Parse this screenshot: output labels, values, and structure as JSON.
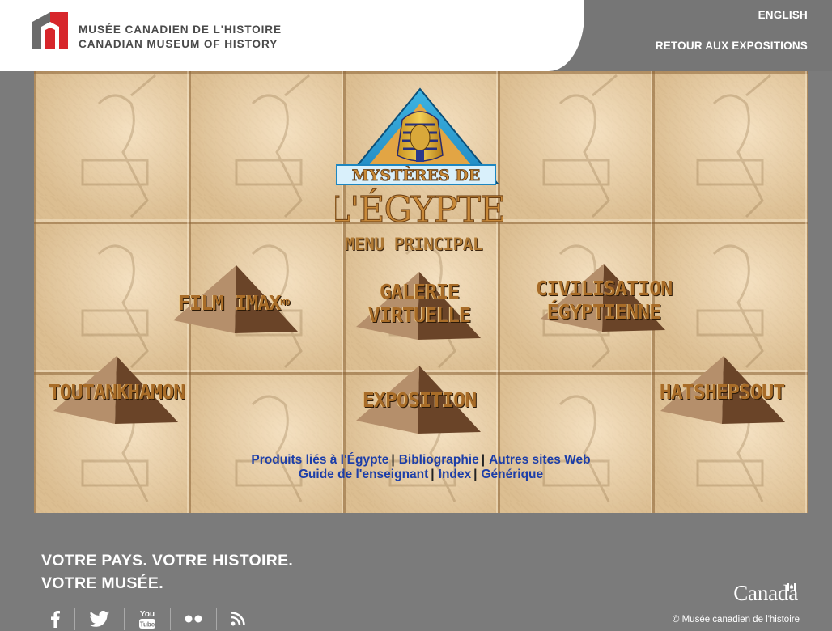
{
  "header": {
    "museum_name_fr": "MUSÉE CANADIEN DE L'HISTOIRE",
    "museum_name_en": "CANADIAN MUSEUM OF HISTORY",
    "english_link": "ENGLISH",
    "retour_link": "RETOUR AUX EXPOSITIONS"
  },
  "main": {
    "title_line1": "MYSTÈRES DE",
    "title_line2": "L'ÉGYPTE",
    "menu_label": "MENU PRINCIPAL",
    "items": [
      {
        "label": "FILM IMAX",
        "suffix": "MD"
      },
      {
        "label_line1": "GALERIE",
        "label_line2": "VIRTUELLE"
      },
      {
        "label_line1": "CIVILISATION",
        "label_line2": "ÉGYPTIENNE"
      },
      {
        "label": "TOUTANKHAMON"
      },
      {
        "label": "EXPOSITION"
      },
      {
        "label": "HATSHEPSOUT"
      }
    ],
    "links_row1": [
      "Produits liés à l'Égypte",
      "Bibliographie",
      "Autres sites Web"
    ],
    "links_row2": [
      "Guide de l'enseignant",
      "Index",
      "Générique"
    ],
    "separator": "|"
  },
  "footer": {
    "slogan_line1": "VOTRE PAYS. VOTRE HISTOIRE.",
    "slogan_line2": "VOTRE MUSÉE.",
    "social_icons": [
      "facebook-icon",
      "twitter-icon",
      "youtube-icon",
      "flickr-icon",
      "rss-icon"
    ],
    "youtube_text": "You Tube",
    "canada_wordmark": "Canada",
    "copyright": "© Musée canadien de l'histoire"
  },
  "colors": {
    "header_gray": "#767676",
    "footer_gray": "#7b7b7b",
    "logo_red": "#d7262b",
    "link_blue": "#1d3ea8",
    "title_gold": "#b07a35",
    "triangle_blue": "#2a9fd0"
  }
}
